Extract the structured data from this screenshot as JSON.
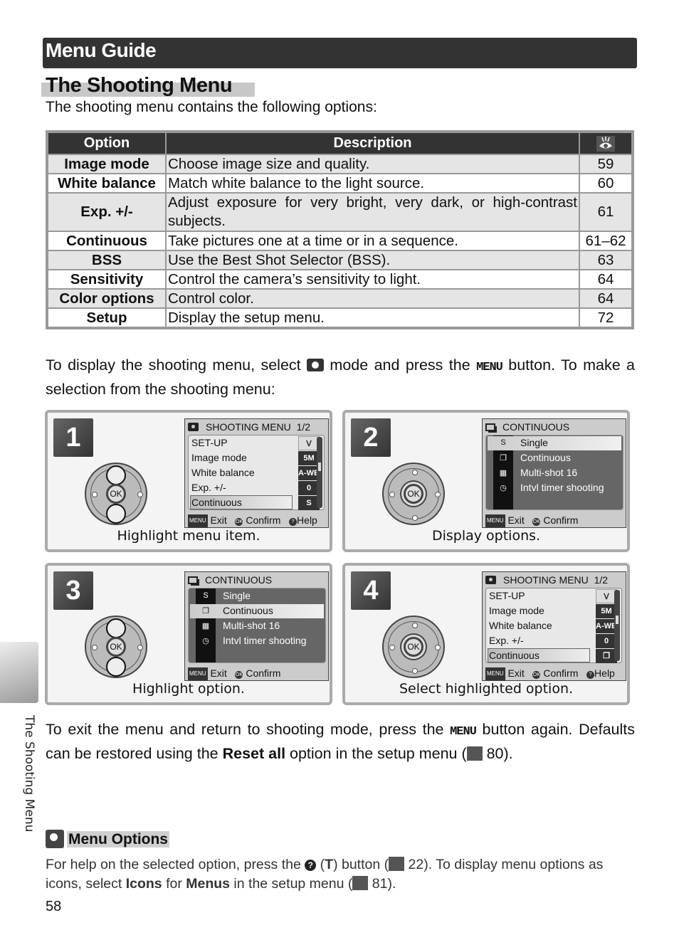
{
  "header": {
    "title": "Menu Guide"
  },
  "section": {
    "title": "The Shooting Menu",
    "intro": "The shooting menu contains the following options:"
  },
  "table": {
    "headers": {
      "option": "Option",
      "description": "Description",
      "page_icon": "reference-eye-icon"
    },
    "rows": [
      {
        "option": "Image mode",
        "description": "Choose image size and quality.",
        "page": "59"
      },
      {
        "option": "White balance",
        "description": "Match white balance to the light source.",
        "page": "60"
      },
      {
        "option": "Exp. +/-",
        "description": "Adjust exposure for very bright, very dark, or high-contrast subjects.",
        "page": "61"
      },
      {
        "option": "Continuous",
        "description": "Take pictures one at a time or in a sequence.",
        "page": "61–62"
      },
      {
        "option": "BSS",
        "description": "Use the Best Shot Selector (BSS).",
        "page": "63"
      },
      {
        "option": "Sensitivity",
        "description": "Control the camera’s sensitivity to light.",
        "page": "64"
      },
      {
        "option": "Color options",
        "description": "Control color.",
        "page": "64"
      },
      {
        "option": "Setup",
        "description": "Display the setup menu.",
        "page": "72"
      }
    ]
  },
  "para1": {
    "part1": "To display the shooting menu, select ",
    "part2": " mode and press the ",
    "menu": "MENU",
    "part3": " button.  To make a selection from the shooting menu:"
  },
  "steps": [
    {
      "num": "1",
      "caption": "Highlight menu item.",
      "screen": {
        "title": "SHOOTING MENU",
        "page": "1/2",
        "items": [
          "SET-UP",
          "Image mode",
          "White balance",
          "Exp. +/-",
          "Continuous"
        ],
        "values": [
          "setup-wrench-icon",
          "5M",
          "A-WB",
          "0",
          "S"
        ],
        "highlighted": "Continuous",
        "footer": {
          "exit": "Exit",
          "confirm": "Confirm",
          "help": "Help",
          "menu_badge": "MENU",
          "ok_badge": "OK",
          "help_badge": "?"
        }
      }
    },
    {
      "num": "2",
      "caption": "Display options.",
      "screen": {
        "title": "CONTINUOUS",
        "items": [
          "Single",
          "Continuous",
          "Multi-shot 16",
          "Intvl timer shooting"
        ],
        "highlighted": "Single",
        "footer": {
          "exit": "Exit",
          "confirm": "Confirm",
          "menu_badge": "MENU",
          "ok_badge": "OK"
        }
      }
    },
    {
      "num": "3",
      "caption": "Highlight option.",
      "screen": {
        "title": "CONTINUOUS",
        "items": [
          "Single",
          "Continuous",
          "Multi-shot 16",
          "Intvl timer shooting"
        ],
        "highlighted": "Continuous",
        "footer": {
          "exit": "Exit",
          "confirm": "Confirm",
          "menu_badge": "MENU",
          "ok_badge": "OK"
        }
      }
    },
    {
      "num": "4",
      "caption": "Select highlighted option.",
      "screen": {
        "title": "SHOOTING MENU",
        "page": "1/2",
        "items": [
          "SET-UP",
          "Image mode",
          "White balance",
          "Exp. +/-",
          "Continuous"
        ],
        "values": [
          "setup-wrench-icon",
          "5M",
          "A-WB",
          "0",
          "continuous-icon"
        ],
        "highlighted": "Continuous",
        "footer": {
          "exit": "Exit",
          "confirm": "Confirm",
          "help": "Help",
          "menu_badge": "MENU",
          "ok_badge": "OK",
          "help_badge": "?"
        }
      }
    }
  ],
  "para2": {
    "part1": "To exit the menu and return to shooting mode, press the ",
    "menu": "MENU",
    "part2": " button again. Defaults can be restored using the ",
    "bold": "Reset all",
    "part3": " option in the setup menu (",
    "ref": " 80)."
  },
  "side": {
    "label": "The Shooting Menu"
  },
  "menu_options": {
    "title": "Menu Options",
    "p1": "For help on the selected option, press the ",
    "q": "?",
    "p2": " (",
    "t": "T",
    "p3": ") button (",
    "ref1": " 22).  To display menu options as icons, select ",
    "b1": "Icons",
    "p4": " for ",
    "b2": "Menus",
    "p5": " in the setup menu (",
    "ref2": " 81)."
  },
  "page_number": "58",
  "colors": {
    "header_bg": "#333333",
    "table_border": "#999999",
    "row_shade": "#e5e5e5"
  }
}
